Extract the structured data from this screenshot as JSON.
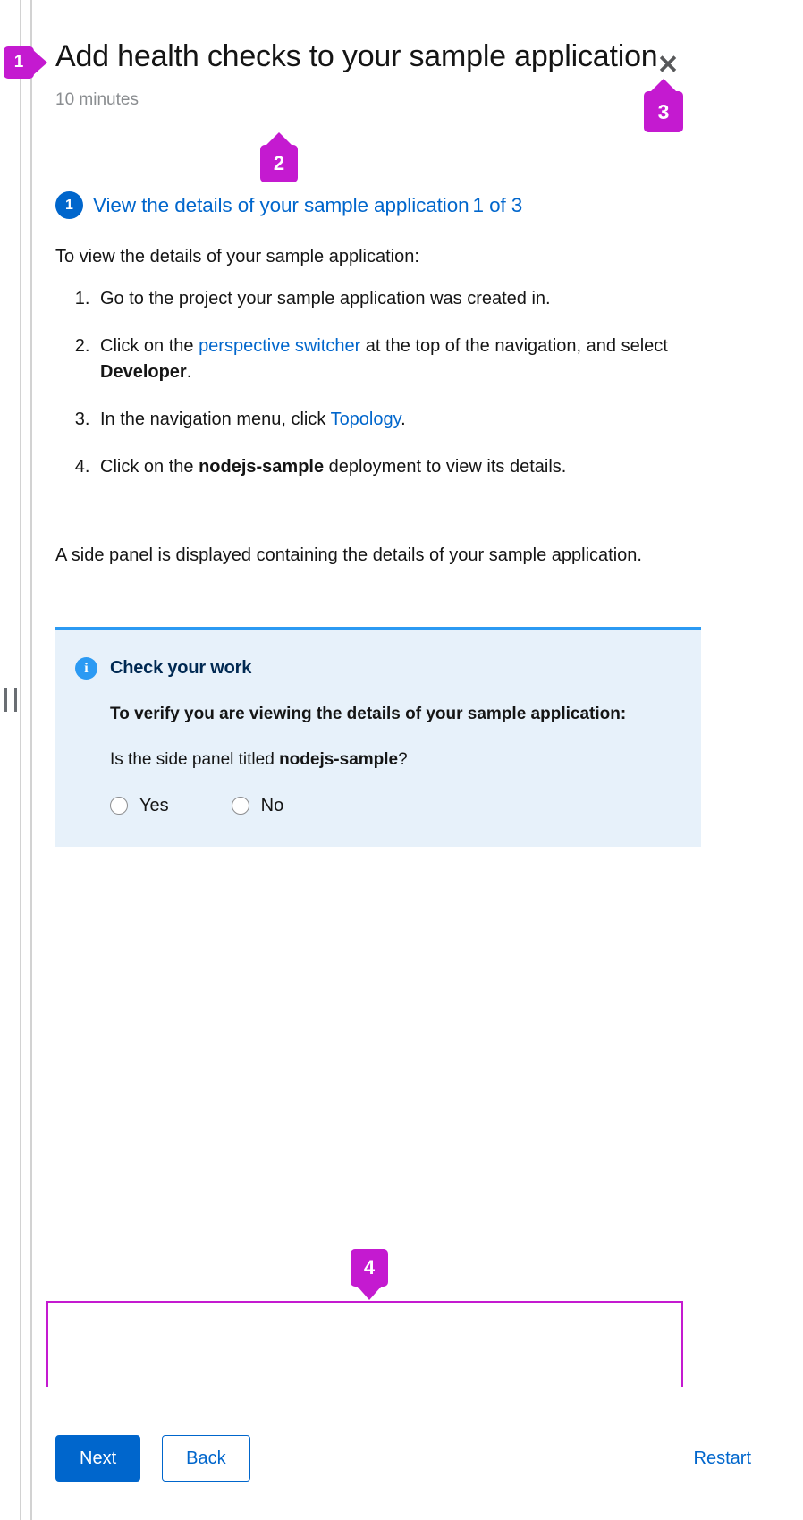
{
  "window": {
    "title": "Add health checks to your sample application",
    "duration": "10 minutes",
    "close_label": "✕",
    "close_icon": "close-icon",
    "resize_grip_icon": "drag-handle-icon"
  },
  "step": {
    "badge": "1",
    "title": "View the details of your sample application",
    "counter": "1 of 3",
    "intro": "To view the details of your sample application:",
    "items": [
      {
        "index": "1",
        "parts": [
          {
            "text": "Go to the project your sample application was created in.",
            "style": "plain"
          }
        ]
      },
      {
        "index": "2",
        "parts": [
          {
            "text": "Click on the ",
            "style": "plain"
          },
          {
            "text": "perspective switcher",
            "style": "link"
          },
          {
            "text": " at the top of the navigation, and select ",
            "style": "plain"
          },
          {
            "text": "Developer",
            "style": "bold"
          },
          {
            "text": ".",
            "style": "plain"
          }
        ]
      },
      {
        "index": "3",
        "parts": [
          {
            "text": "In the navigation menu, click ",
            "style": "plain"
          },
          {
            "text": "Topology",
            "style": "link"
          },
          {
            "text": ".",
            "style": "plain"
          }
        ]
      },
      {
        "index": "4",
        "parts": [
          {
            "text": "Click on the ",
            "style": "plain"
          },
          {
            "text": "nodejs-sample",
            "style": "bold"
          },
          {
            "text": " deployment to view its details.",
            "style": "plain"
          }
        ]
      }
    ],
    "outro": "A side panel is displayed containing the details of your sample application."
  },
  "check_your_work": {
    "icon": "info-circle-icon",
    "title": "Check your work",
    "verify_text": "To verify you are viewing the details of your sample application:",
    "question_prefix": "Is the side panel titled ",
    "question_bold": "nodejs-sample",
    "question_suffix": "?",
    "options": [
      {
        "value": "yes",
        "label": "Yes",
        "selected": false
      },
      {
        "value": "no",
        "label": "No",
        "selected": false
      }
    ]
  },
  "footer": {
    "next_label": "Next",
    "back_label": "Back",
    "restart_label": "Restart"
  },
  "annotations": [
    {
      "id": "1",
      "label": "1",
      "target": "page-title"
    },
    {
      "id": "2",
      "label": "2",
      "target": "duration-text"
    },
    {
      "id": "3",
      "label": "3",
      "target": "close-button"
    },
    {
      "id": "4",
      "label": "4",
      "target": "footer-actions"
    }
  ],
  "colors": {
    "accent_blue": "#0066CC",
    "info_blue": "#2B9AF3",
    "info_panel_bg": "#E7F1FA",
    "info_title": "#002952",
    "text": "#151515",
    "muted": "#8A8D90",
    "marker_magenta": "#C41AD0"
  }
}
